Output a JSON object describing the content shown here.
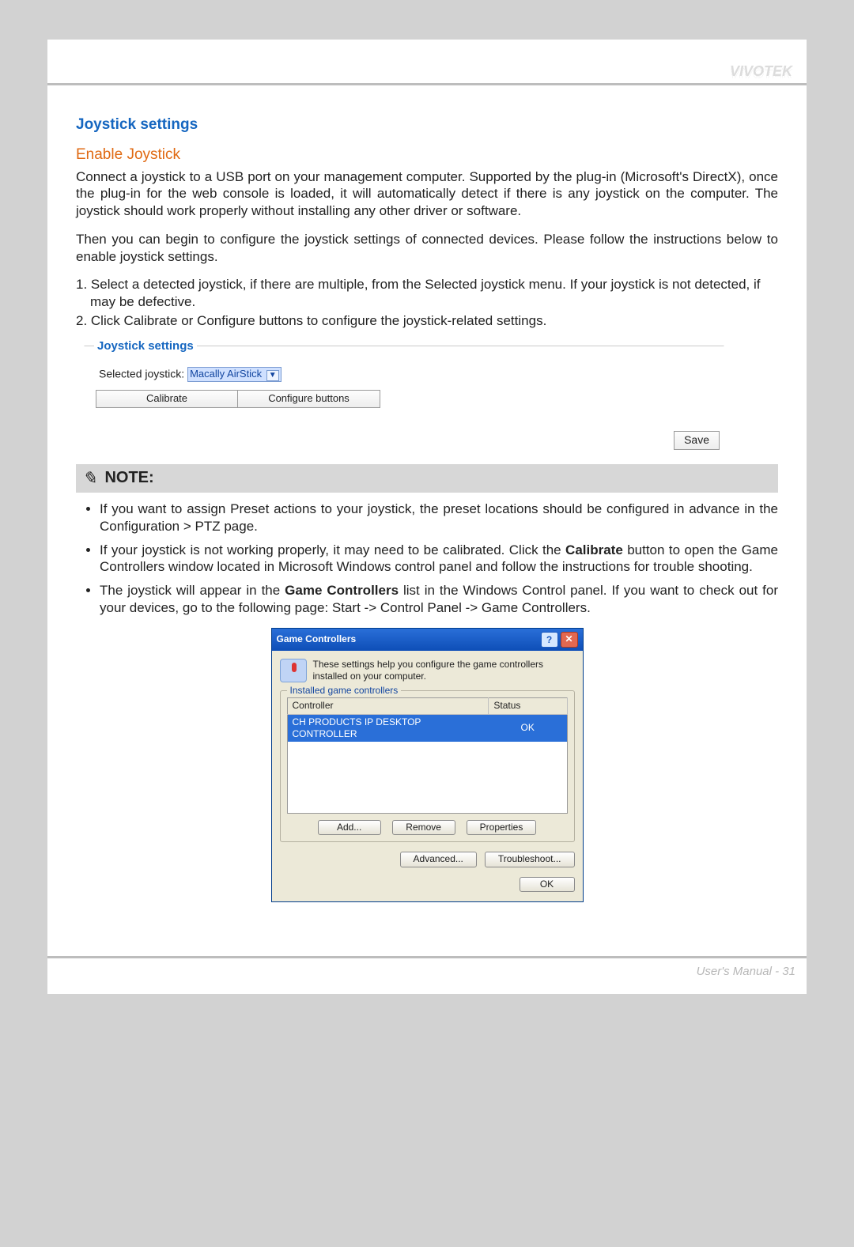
{
  "brand": "VIVOTEK",
  "headings": {
    "joystick": "Joystick settings",
    "enable": "Enable Joystick"
  },
  "para1": "Connect a joystick to a USB port on your management computer. Supported by the plug-in (Microsoft's DirectX), once the plug-in for the web console is loaded, it will automatically detect if there is any joystick on the computer. The joystick should work properly without installing any other driver or software.",
  "para2": "Then you can begin to configure the joystick settings of connected devices. Please follow the instructions below to enable joystick settings.",
  "steps": {
    "s1": "1. Select a detected joystick, if there are multiple, from the Selected joystick menu. If your joystick is not detected, if may be defective.",
    "s2": "2. Click Calibrate or Configure buttons to configure the joystick-related settings."
  },
  "panel": {
    "legend": "Joystick settings",
    "selected_label": "Selected joystick:",
    "selected_value": "Macally AirStick",
    "calibrate": "Calibrate",
    "configure": "Configure buttons",
    "save": "Save"
  },
  "note": {
    "label": "NOTE:",
    "b1_a": "If you want to assign Preset actions to your joystick, the preset locations should be configured in advance in the Configuration > PTZ page.",
    "b2_a": "If your joystick is not working properly, it may need to be calibrated. Click the ",
    "b2_bold": "Calibrate",
    "b2_b": " button to open the Game Controllers window located in Microsoft Windows control panel and follow the instructions for trouble shooting.",
    "b3_a": "The joystick will appear in the ",
    "b3_bold": "Game Controllers",
    "b3_b": " list in the Windows Control panel. If you want to check out for your devices, go to the following page: Start -> Control Panel -> Game Controllers."
  },
  "xp": {
    "title": "Game Controllers",
    "desc": "These settings help you configure the game controllers installed on your computer.",
    "fieldset": "Installed game controllers",
    "col_controller": "Controller",
    "col_status": "Status",
    "row_controller": "CH PRODUCTS IP DESKTOP CONTROLLER",
    "row_status": "OK",
    "add": "Add...",
    "remove": "Remove",
    "properties": "Properties",
    "advanced": "Advanced...",
    "troubleshoot": "Troubleshoot...",
    "ok": "OK"
  },
  "footer": "User's Manual - 31"
}
